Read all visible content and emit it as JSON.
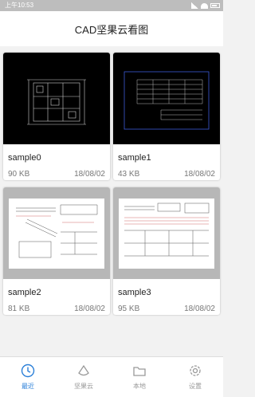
{
  "status_bar": {
    "time": "上午10:53"
  },
  "header": {
    "title": "CAD坚果云看图"
  },
  "files": [
    {
      "name": "sample0",
      "size": "90 KB",
      "date": "18/08/02"
    },
    {
      "name": "sample1",
      "size": "43 KB",
      "date": "18/08/02"
    },
    {
      "name": "sample2",
      "size": "81 KB",
      "date": "18/08/02"
    },
    {
      "name": "sample3",
      "size": "95 KB",
      "date": "18/08/02"
    }
  ],
  "tabs": [
    {
      "label": "最近",
      "icon": "clock-icon"
    },
    {
      "label": "坚果云",
      "icon": "nutstore-icon"
    },
    {
      "label": "本地",
      "icon": "folder-icon"
    },
    {
      "label": "设置",
      "icon": "gear-icon"
    }
  ],
  "colors": {
    "accent": "#2a7fd8",
    "inactive": "#999999",
    "dark_thumb": "#000000",
    "light_thumb": "#b7b7b7"
  }
}
